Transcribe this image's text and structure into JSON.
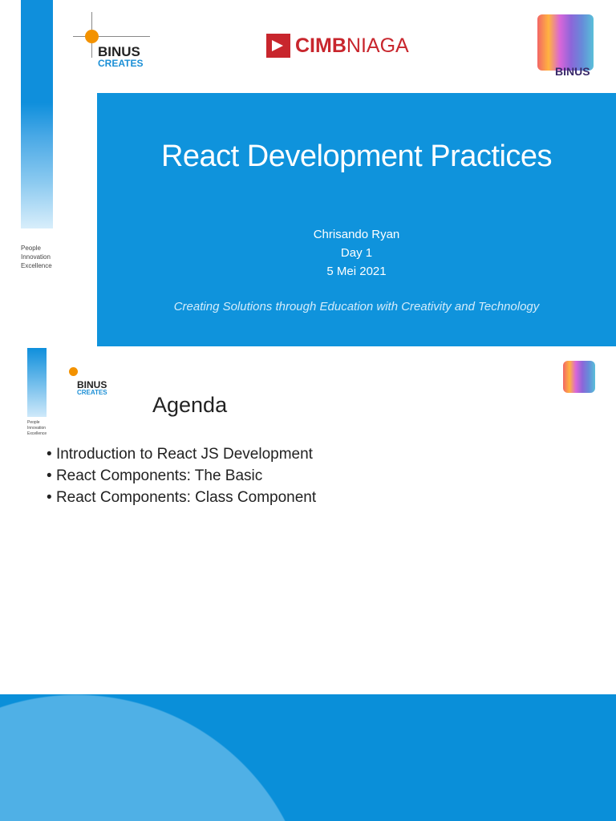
{
  "slide1": {
    "title": "React Development Practices",
    "presenter": "Chrisando Ryan",
    "day": "Day 1",
    "date": "5 Mei 2021",
    "tagline": "Creating Solutions through Education with Creativity and Technology",
    "sidebar_text": [
      "People",
      "Innovation",
      "Excellence"
    ],
    "logo_binus": [
      "BINUS",
      "CREATES"
    ],
    "logo_cimb": [
      "CIMB",
      "NIAGA"
    ],
    "logo_anniv": "BINUS"
  },
  "slide2": {
    "heading": "Agenda",
    "items": [
      "Introduction to React JS Development",
      "React Components: The Basic",
      "React Components: Class Component"
    ],
    "sidebar_text": [
      "People",
      "Innovation",
      "Excellence"
    ],
    "logo_binus": [
      "BINUS",
      "CREATES"
    ]
  },
  "colors": {
    "blue": "#0f93dc",
    "cimb_red": "#c8262d"
  }
}
